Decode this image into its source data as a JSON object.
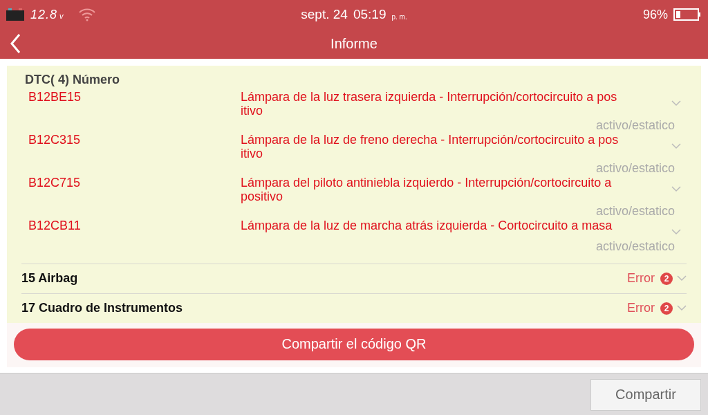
{
  "status_bar": {
    "voltage": "12.8",
    "voltage_unit": "v",
    "date": "sept. 24",
    "time": "05:19",
    "ampm": "p. m.",
    "battery": "96%"
  },
  "header": {
    "title": "Informe"
  },
  "dtc_section": {
    "heading": "DTC( 4) Número",
    "codes": [
      {
        "code": "B12BE15",
        "description": [
          "Lámpara de la luz trasera izquierda - Interrupción/cortocircuito a pos",
          "itivo"
        ],
        "status": "activo/estatico"
      },
      {
        "code": "B12C315",
        "description": [
          "Lámpara de la luz de freno derecha - Interrupción/cortocircuito a pos",
          "itivo"
        ],
        "status": "activo/estatico"
      },
      {
        "code": "B12C715",
        "description": [
          "Lámpara del piloto antiniebla izquierdo - Interrupción/cortocircuito a",
          "positivo"
        ],
        "status": "activo/estatico"
      },
      {
        "code": "B12CB11",
        "description": [
          "Lámpara de la luz de marcha atrás izquierda - Cortocircuito a masa"
        ],
        "status": "activo/estatico"
      }
    ]
  },
  "systems": [
    {
      "name": "15 Airbag",
      "result": "Error",
      "count": "2"
    },
    {
      "name": "17 Cuadro de Instrumentos",
      "result": "Error",
      "count": "2"
    }
  ],
  "qr_button": "Compartir el código QR",
  "footer": {
    "share_button": "Compartir"
  }
}
